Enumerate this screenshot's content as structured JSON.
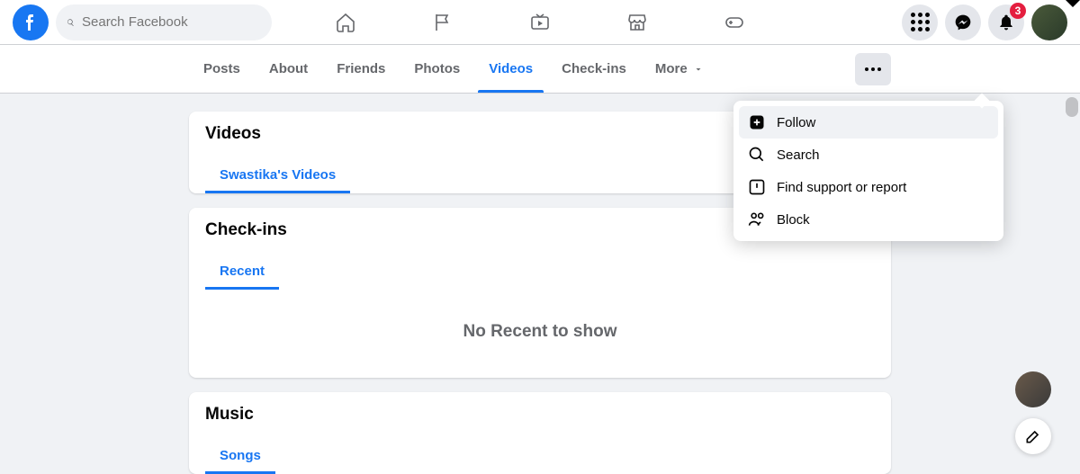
{
  "header": {
    "search_placeholder": "Search Facebook",
    "notification_count": "3"
  },
  "tabs": {
    "posts": "Posts",
    "about": "About",
    "friends": "Friends",
    "photos": "Photos",
    "videos": "Videos",
    "checkins": "Check-ins",
    "more": "More"
  },
  "menu": {
    "follow": "Follow",
    "search": "Search",
    "report": "Find support or report",
    "block": "Block"
  },
  "videos_card": {
    "title": "Videos",
    "subtab": "Swastika's Videos"
  },
  "checkins_card": {
    "title": "Check-ins",
    "subtab": "Recent",
    "empty": "No Recent to show"
  },
  "music_card": {
    "title": "Music",
    "subtab": "Songs"
  }
}
